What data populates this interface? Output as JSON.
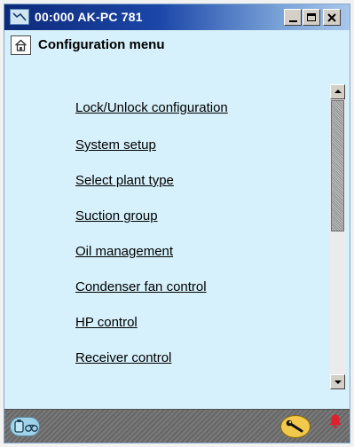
{
  "window": {
    "title": "00:000 AK-PC 781",
    "colors": {
      "titlebar_start": "#0d2a7a",
      "titlebar_end": "#a9c6ea",
      "content_bg": "#d6f1fb",
      "alarm": "#e0202a",
      "wrench_badge": "#f2c94c"
    },
    "icons": {
      "app": "settings-app-icon",
      "minimize": "minimize-icon",
      "maximize": "maximize-icon",
      "close": "close-icon"
    }
  },
  "header": {
    "title": "Configuration menu",
    "home_icon": "home-icon"
  },
  "menu": {
    "items": [
      {
        "label": "Lock/Unlock configuration"
      },
      {
        "label": "System setup"
      },
      {
        "label": "Select plant type"
      },
      {
        "label": "Suction group"
      },
      {
        "label": "Oil management"
      },
      {
        "label": "Condenser fan control"
      },
      {
        "label": "HP control"
      },
      {
        "label": "Receiver control"
      }
    ]
  },
  "scrollbar": {
    "visible_fraction": 0.48,
    "position": 0.0
  },
  "status_bar": {
    "left_icon": "controller-binoculars-icon",
    "wrench_icon": "wrench-icon",
    "alarm_icon": "alarm-bell-icon"
  }
}
